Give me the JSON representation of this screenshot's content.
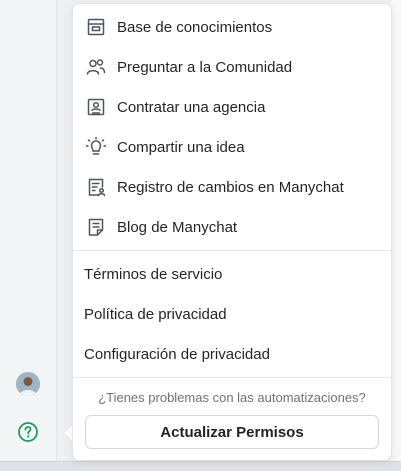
{
  "menu": {
    "items": [
      {
        "label": "Base de conocimientos",
        "icon": "archive-icon"
      },
      {
        "label": "Preguntar a la Comunidad",
        "icon": "users-icon"
      },
      {
        "label": "Contratar una agencia",
        "icon": "id-card-icon"
      },
      {
        "label": "Compartir una idea",
        "icon": "lightbulb-icon"
      },
      {
        "label": "Registro de cambios en Manychat",
        "icon": "changelog-icon"
      },
      {
        "label": "Blog de Manychat",
        "icon": "document-icon"
      }
    ],
    "links": [
      {
        "label": "Términos de servicio"
      },
      {
        "label": "Política de privacidad"
      },
      {
        "label": "Configuración de privacidad"
      }
    ],
    "hint": "¿Tienes problemas con las automatizaciones?",
    "update_button": "Actualizar Permisos"
  },
  "sidebar": {
    "avatar": "user-avatar",
    "help_icon": "help-circle-icon"
  },
  "colors": {
    "help_icon": "#1f9d5a",
    "icon_stroke": "#4b5563",
    "text": "#1f2328",
    "muted": "#6b7280"
  }
}
